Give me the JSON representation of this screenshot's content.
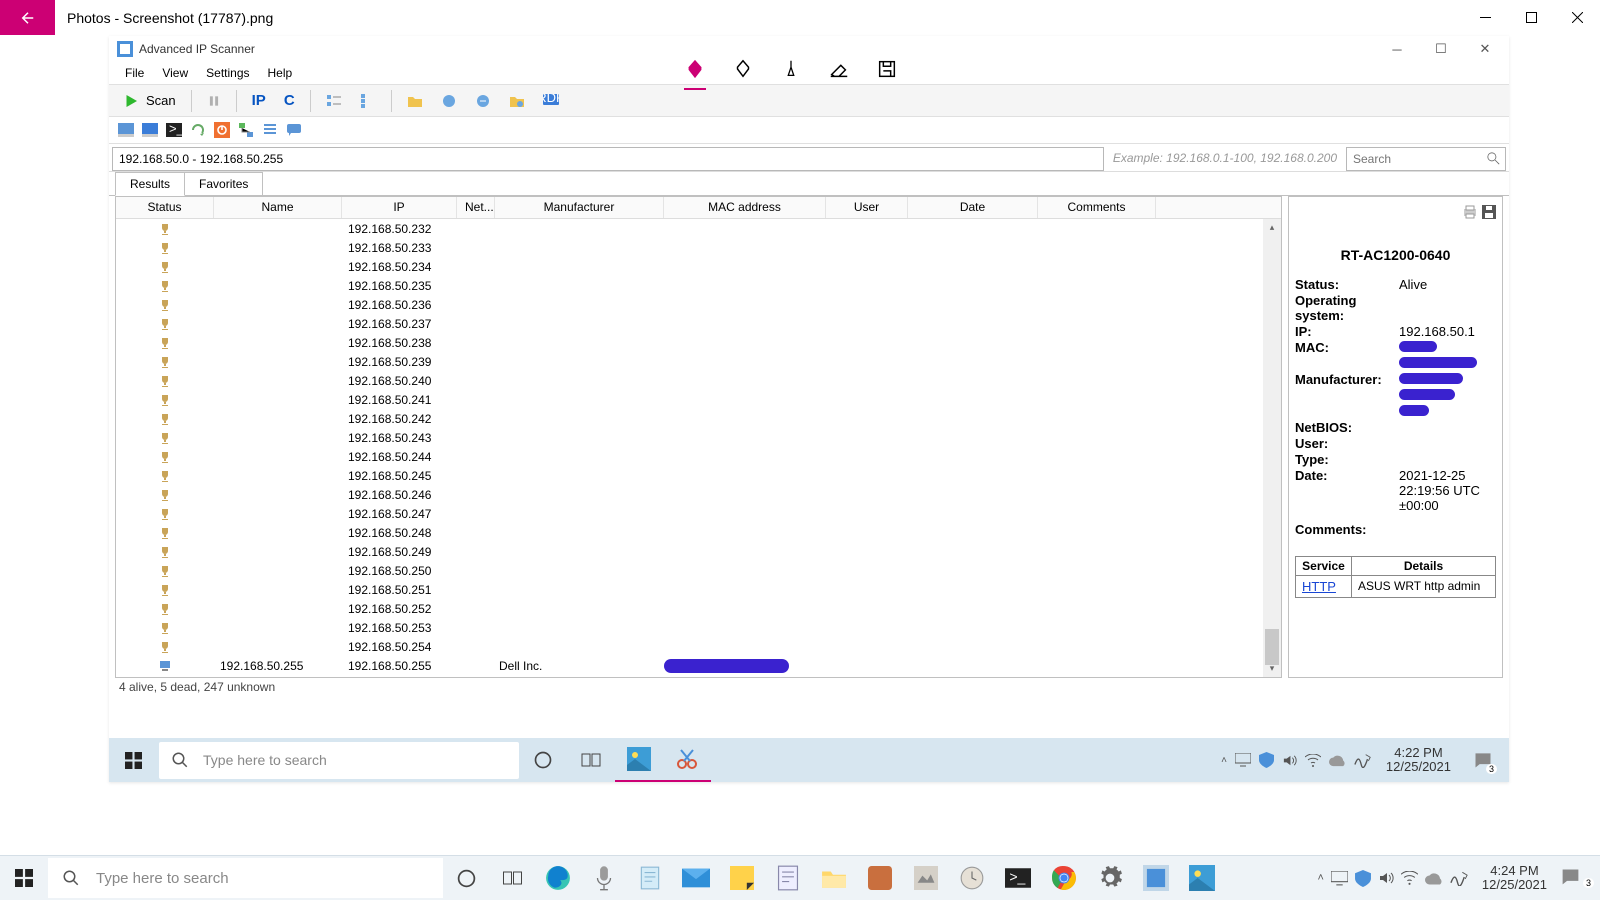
{
  "photos": {
    "title": "Photos - Screenshot (17787).png"
  },
  "inner": {
    "title": "Advanced IP Scanner",
    "menu": [
      "File",
      "View",
      "Settings",
      "Help"
    ],
    "scan": "Scan",
    "ip_range": "192.168.50.0 - 192.168.50.255",
    "example": "Example: 192.168.0.1-100, 192.168.0.200",
    "search_ph": "Search",
    "tabs": {
      "results": "Results",
      "favorites": "Favorites"
    },
    "columns": {
      "status": "Status",
      "name": "Name",
      "ip": "IP",
      "net": "Net...",
      "man": "Manufacturer",
      "mac": "MAC address",
      "user": "User",
      "date": "Date",
      "com": "Comments"
    },
    "rows": [
      {
        "ip": "192.168.50.232"
      },
      {
        "ip": "192.168.50.233"
      },
      {
        "ip": "192.168.50.234"
      },
      {
        "ip": "192.168.50.235"
      },
      {
        "ip": "192.168.50.236"
      },
      {
        "ip": "192.168.50.237"
      },
      {
        "ip": "192.168.50.238"
      },
      {
        "ip": "192.168.50.239"
      },
      {
        "ip": "192.168.50.240"
      },
      {
        "ip": "192.168.50.241"
      },
      {
        "ip": "192.168.50.242"
      },
      {
        "ip": "192.168.50.243"
      },
      {
        "ip": "192.168.50.244"
      },
      {
        "ip": "192.168.50.245"
      },
      {
        "ip": "192.168.50.246"
      },
      {
        "ip": "192.168.50.247"
      },
      {
        "ip": "192.168.50.248"
      },
      {
        "ip": "192.168.50.249"
      },
      {
        "ip": "192.168.50.250"
      },
      {
        "ip": "192.168.50.251"
      },
      {
        "ip": "192.168.50.252"
      },
      {
        "ip": "192.168.50.253"
      },
      {
        "ip": "192.168.50.254"
      },
      {
        "ip": "192.168.50.255",
        "name": "192.168.50.255",
        "man": "Dell Inc.",
        "mac_redact": true,
        "pc": true
      }
    ],
    "status": "4 alive, 5 dead, 247 unknown",
    "side": {
      "title": "RT-AC1200-0640",
      "status_l": "Status:",
      "status_v": "Alive",
      "os_l": "Operating system:",
      "ip_l": "IP:",
      "ip_v": "192.168.50.1",
      "mac_l": "MAC:",
      "man_l": "Manufacturer:",
      "nb_l": "NetBIOS:",
      "user_l": "User:",
      "type_l": "Type:",
      "date_l": "Date:",
      "date_v": "2021-12-25 22:19:56 UTC ±00:00",
      "com_l": "Comments:",
      "svc_h1": "Service",
      "svc_h2": "Details",
      "svc_v1": "HTTP",
      "svc_v2": "ASUS WRT http admin"
    },
    "tb": {
      "search_ph": "Type here to search",
      "time": "4:22 PM",
      "date": "12/25/2021",
      "notif": "3"
    }
  },
  "outer_tb": {
    "search_ph": "Type here to search",
    "time": "4:24 PM",
    "date": "12/25/2021",
    "notif": "3"
  }
}
